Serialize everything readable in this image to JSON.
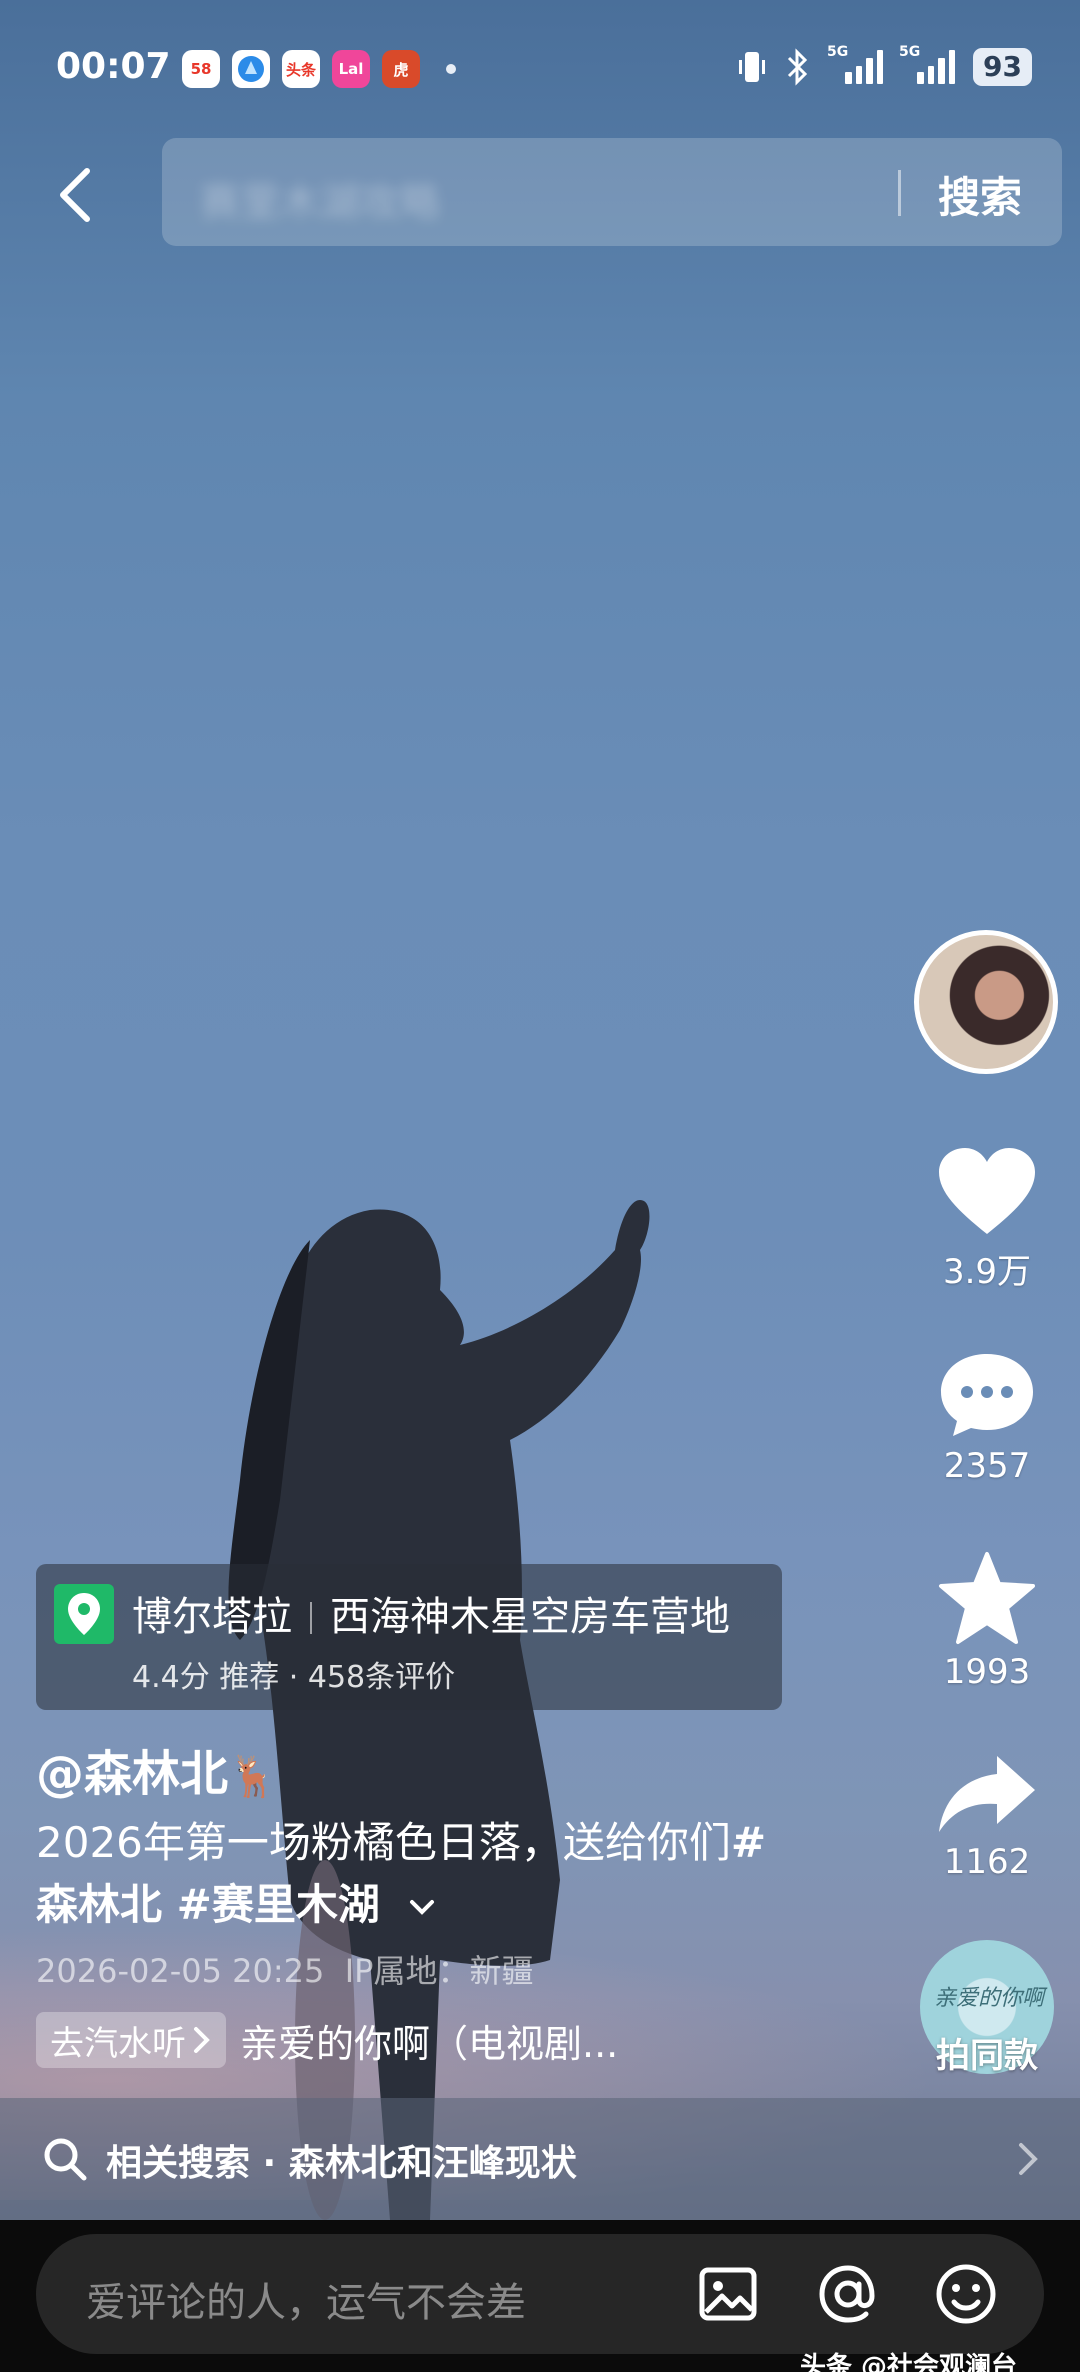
{
  "status_bar": {
    "time": "00:07",
    "app_icons": [
      {
        "name": "app-58-icon",
        "text": "58",
        "bg": "#ffffff",
        "fg": "#e8372a"
      },
      {
        "name": "app-browser-icon",
        "text": "",
        "bg": "#ffffff",
        "fg": "#1e88e5"
      },
      {
        "name": "app-toutiao-icon",
        "text": "头条",
        "bg": "#ffffff",
        "fg": "#e8372a"
      },
      {
        "name": "app-pink-icon",
        "text": "Lal",
        "bg": "#f0469a",
        "fg": "#ffffff"
      },
      {
        "name": "app-game-icon",
        "text": "虎",
        "bg": "#d94a2a",
        "fg": "#ffffff"
      }
    ],
    "network_label_1": "5G",
    "network_label_2": "5G",
    "battery": "93"
  },
  "header": {
    "search_placeholder": "赛里木湖攻略",
    "search_button": "搜索"
  },
  "rail": {
    "likes": "3.9万",
    "comments": "2357",
    "favorites": "1993",
    "shares": "1162",
    "same_style": "拍同款",
    "disc_text": "亲爱的你啊"
  },
  "location": {
    "name_1": "博尔塔拉",
    "name_2": "西海神木星空房车营地",
    "meta": "4.4分 推荐 · 458条评价"
  },
  "post": {
    "author": "@森林北",
    "author_emoji": "🦌",
    "caption_text": "2026年第一场粉橘色日落，送给你们",
    "caption_hash": "#",
    "caption_tags": "森林北 #赛里木湖",
    "date": "2026-02-05 20:25",
    "ip": "IP属地：新疆"
  },
  "music": {
    "chip_label": "去汽水听",
    "title": "亲爱的你啊（电视剧..."
  },
  "related": {
    "label": "相关搜索 · 森林北和汪峰现状"
  },
  "comment": {
    "placeholder": "爱评论的人，运气不会差"
  },
  "watermark": "头条 @社会观澜台",
  "colors": {
    "location_pin": "#1fb968",
    "sky_top": "#4a6f9a",
    "sky_mid": "#6d8eb8"
  }
}
